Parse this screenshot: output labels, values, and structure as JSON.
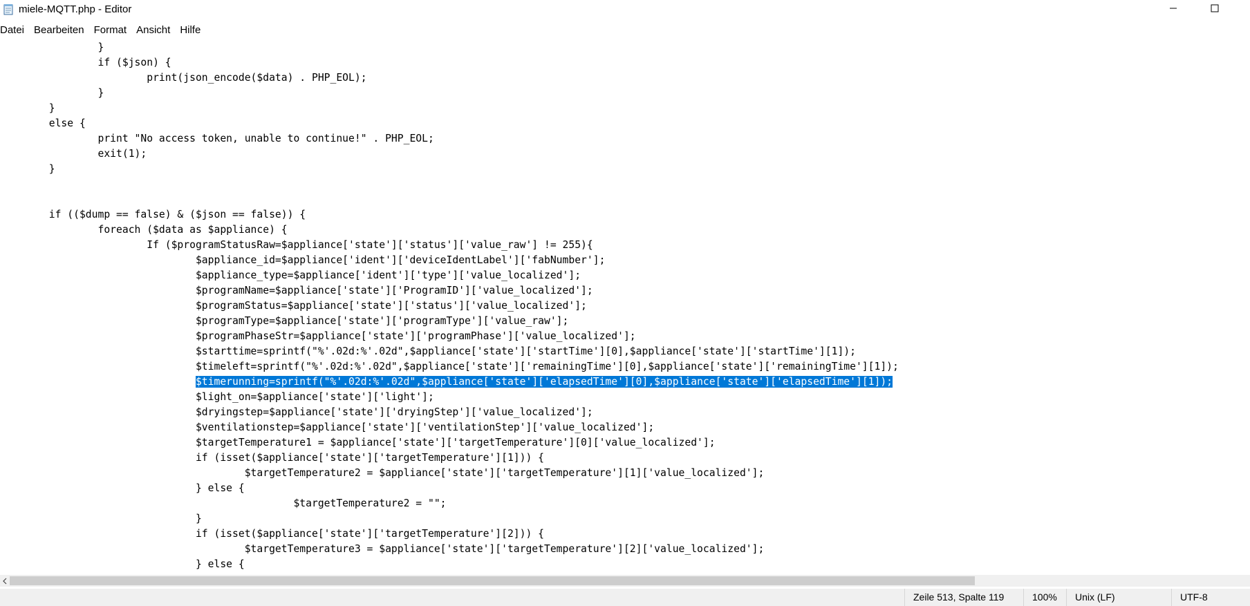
{
  "window": {
    "title": "miele-MQTT.php - Editor",
    "icons": {
      "app": "notepad-icon",
      "minimize": "minimize-icon",
      "maximize": "maximize-icon"
    }
  },
  "menu": {
    "items": [
      {
        "label": "Datei"
      },
      {
        "label": "Bearbeiten"
      },
      {
        "label": "Format"
      },
      {
        "label": "Ansicht"
      },
      {
        "label": "Hilfe"
      }
    ]
  },
  "editor": {
    "selection_color": "#0078d7",
    "lines": [
      {
        "text": "\t\t}"
      },
      {
        "text": "\t\tif ($json) {"
      },
      {
        "text": "\t\t\tprint(json_encode($data) . PHP_EOL);"
      },
      {
        "text": "\t\t}"
      },
      {
        "text": "\t}"
      },
      {
        "text": "\telse {"
      },
      {
        "text": "\t\tprint \"No access token, unable to continue!\" . PHP_EOL;"
      },
      {
        "text": "\t\texit(1);"
      },
      {
        "text": "\t}"
      },
      {
        "text": ""
      },
      {
        "text": ""
      },
      {
        "text": "\tif (($dump == false) & ($json == false)) {"
      },
      {
        "text": "\t\tforeach ($data as $appliance) {"
      },
      {
        "text": "\t\t\tIf ($programStatusRaw=$appliance['state']['status']['value_raw'] != 255){"
      },
      {
        "text": "\t\t\t\t$appliance_id=$appliance['ident']['deviceIdentLabel']['fabNumber'];"
      },
      {
        "text": "\t\t\t\t$appliance_type=$appliance['ident']['type']['value_localized'];"
      },
      {
        "text": "\t\t\t\t$programName=$appliance['state']['ProgramID']['value_localized'];"
      },
      {
        "text": "\t\t\t\t$programStatus=$appliance['state']['status']['value_localized'];"
      },
      {
        "text": "\t\t\t\t$programType=$appliance['state']['programType']['value_raw'];"
      },
      {
        "text": "\t\t\t\t$programPhaseStr=$appliance['state']['programPhase']['value_localized'];"
      },
      {
        "text": "\t\t\t\t$starttime=sprintf(\"%'.02d:%'.02d\",$appliance['state']['startTime'][0],$appliance['state']['startTime'][1]);"
      },
      {
        "text": "\t\t\t\t$timeleft=sprintf(\"%'.02d:%'.02d\",$appliance['state']['remainingTime'][0],$appliance['state']['remainingTime'][1]);"
      },
      {
        "indent": "\t\t\t\t",
        "selected": "$timerunning=sprintf(\"%'.02d:%'.02d\",$appliance['state']['elapsedTime'][0],$appliance['state']['elapsedTime'][1]);"
      },
      {
        "text": "\t\t\t\t$light_on=$appliance['state']['light'];"
      },
      {
        "text": "\t\t\t\t$dryingstep=$appliance['state']['dryingStep']['value_localized'];"
      },
      {
        "text": "\t\t\t\t$ventilationstep=$appliance['state']['ventilationStep']['value_localized'];"
      },
      {
        "text": "\t\t\t\t$targetTemperature1 = $appliance['state']['targetTemperature'][0]['value_localized'];"
      },
      {
        "text": "\t\t\t\tif (isset($appliance['state']['targetTemperature'][1])) {"
      },
      {
        "text": "\t\t\t\t\t$targetTemperature2 = $appliance['state']['targetTemperature'][1]['value_localized'];"
      },
      {
        "text": "\t\t\t\t} else {"
      },
      {
        "text": "\t\t\t\t\t\t$targetTemperature2 = \"\";"
      },
      {
        "text": "\t\t\t\t}"
      },
      {
        "text": "\t\t\t\tif (isset($appliance['state']['targetTemperature'][2])) {"
      },
      {
        "text": "\t\t\t\t\t$targetTemperature3 = $appliance['state']['targetTemperature'][2]['value_localized'];"
      },
      {
        "text": "\t\t\t\t} else {"
      }
    ]
  },
  "scrollbar": {
    "left_arrow_icon": "chevron-left-icon"
  },
  "status": {
    "position": "Zeile 513, Spalte 119",
    "zoom": "100%",
    "line_ending": "Unix (LF)",
    "encoding": "UTF-8"
  }
}
